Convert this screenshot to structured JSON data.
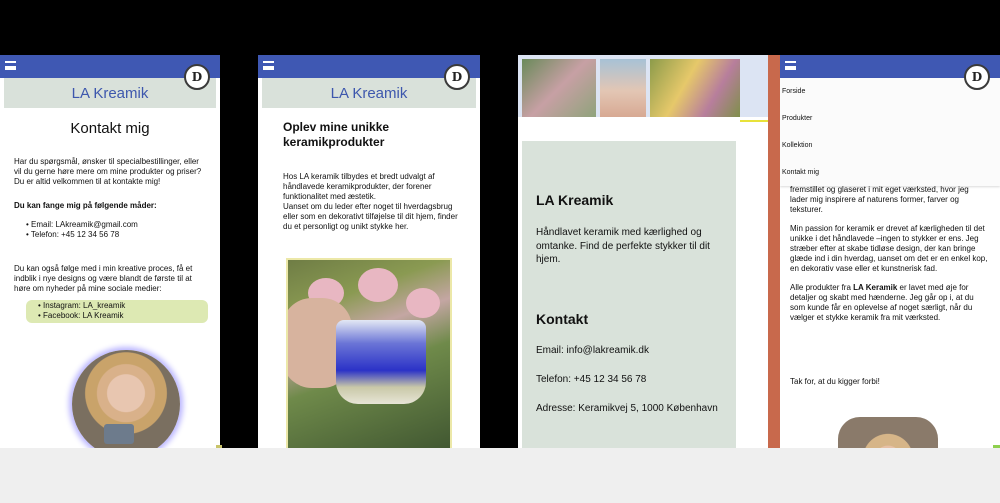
{
  "brand": {
    "name": "LA Kreamik",
    "logo_letter": "D"
  },
  "panel1": {
    "title": "Kontakt mig",
    "intro1": "Har du spørgsmål, ønsker til specialbestillinger, eller vil du gerne høre mere om mine produkter og priser?",
    "intro2": "Du er altid velkommen til at kontakte mig!",
    "ways_heading": "Du kan fange mig på følgende måder:",
    "email": "Email: LAkreamik@gmail.com",
    "phone": "Telefon: +45 12 34 56 78",
    "follow_text": "Du kan også følge med i min kreative proces, få et indblik i nye designs og være blandt de første til at høre om nyheder på mine sociale medier:",
    "instagram": "Instagram: LA_kreamik",
    "facebook": "Facebook: LA Kreamik"
  },
  "panel2": {
    "title": "Oplev mine unikke keramikprodukter",
    "para1": "Hos LA keramik tilbydes et bredt udvalgt af håndlavede keramikprodukter, der forener funktionalitet med æstetik.",
    "para2": "Uanset om du leder efter noget til hverdagsbrug eller som en dekorativt tilføjelse til dit hjem, finder du et personligt og unikt stykke her."
  },
  "panel3": {
    "heading": "LA Kreamik",
    "tagline": "Håndlavet keramik med kærlighed og omtanke. Find de perfekte stykker til dit hjem.",
    "contact_heading": "Kontakt",
    "email": "Email: info@lakreamik.dk",
    "phone": "Telefon: +45 12 34 56 78",
    "address": "Adresse: Keramikvej 5, 1000 København"
  },
  "panel4": {
    "menu": [
      "Forside",
      "Produkter",
      "Kollektion",
      "Kontakt mig"
    ],
    "para1": "fremstillet og glaseret i mit eget værksted, hvor jeg lader mig inspirere af naturens former, farver og teksturer.",
    "para2": "Min passion for keramik er drevet af kærligheden til det unikke i det håndlavede –ingen to stykker er ens. Jeg stræber efter at skabe tidløse design, der kan bringe glæde ind i din hverdag, uanset om det er en enkel kop, en dekorativ vase eller et kunstnerisk fad.",
    "para3_prefix": "Alle produkter fra ",
    "para3_bold": "LA Keramik",
    "para3_suffix": " er lavet med øje for detaljer og skabt med hænderne. Jeg går op i, at du som kunde får en oplevelse af noget særligt, når du vælger et stykke keramik fra mit værksted.",
    "thanks": "Tak for, at du kigger forbi!"
  }
}
